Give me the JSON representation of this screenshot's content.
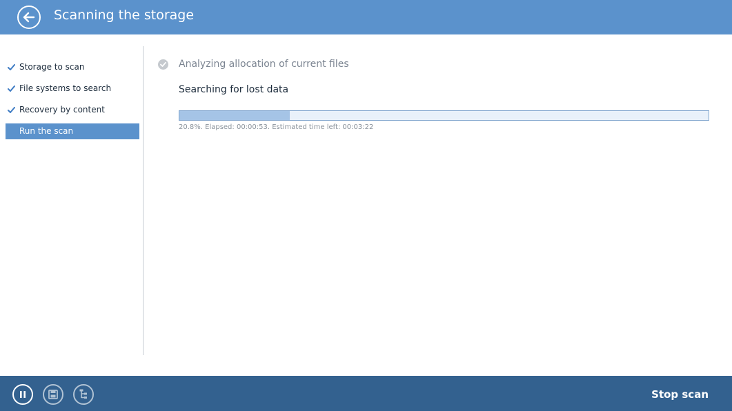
{
  "header": {
    "title": "Scanning the storage",
    "back_icon": "back-arrow-icon",
    "background_color": "#5b92cc"
  },
  "sidebar": {
    "steps": [
      {
        "label": "Storage to scan",
        "completed": true,
        "icon": "checkmark-icon"
      },
      {
        "label": "File systems to search",
        "completed": true,
        "icon": "checkmark-icon"
      },
      {
        "label": "Recovery by content",
        "completed": true,
        "icon": "checkmark-icon"
      },
      {
        "label": "Run the scan",
        "completed": false,
        "active": true
      }
    ],
    "active_color": "#5b92cc"
  },
  "main": {
    "completed_task": "Analyzing allocation of current files",
    "completed_task_icon": "check-circle-icon",
    "current_task": "Searching for lost data",
    "progress_percent": 20.8,
    "progress_text": "20.8%. Elapsed: 00:00:53. Estimated time left: 00:03:22"
  },
  "footer": {
    "buttons": [
      {
        "name": "pause",
        "icon": "pause-icon"
      },
      {
        "name": "save",
        "icon": "floppy-disk-icon"
      },
      {
        "name": "tree",
        "icon": "tree-view-icon"
      }
    ],
    "stop_label": "Stop scan",
    "background_color": "#33618f"
  }
}
